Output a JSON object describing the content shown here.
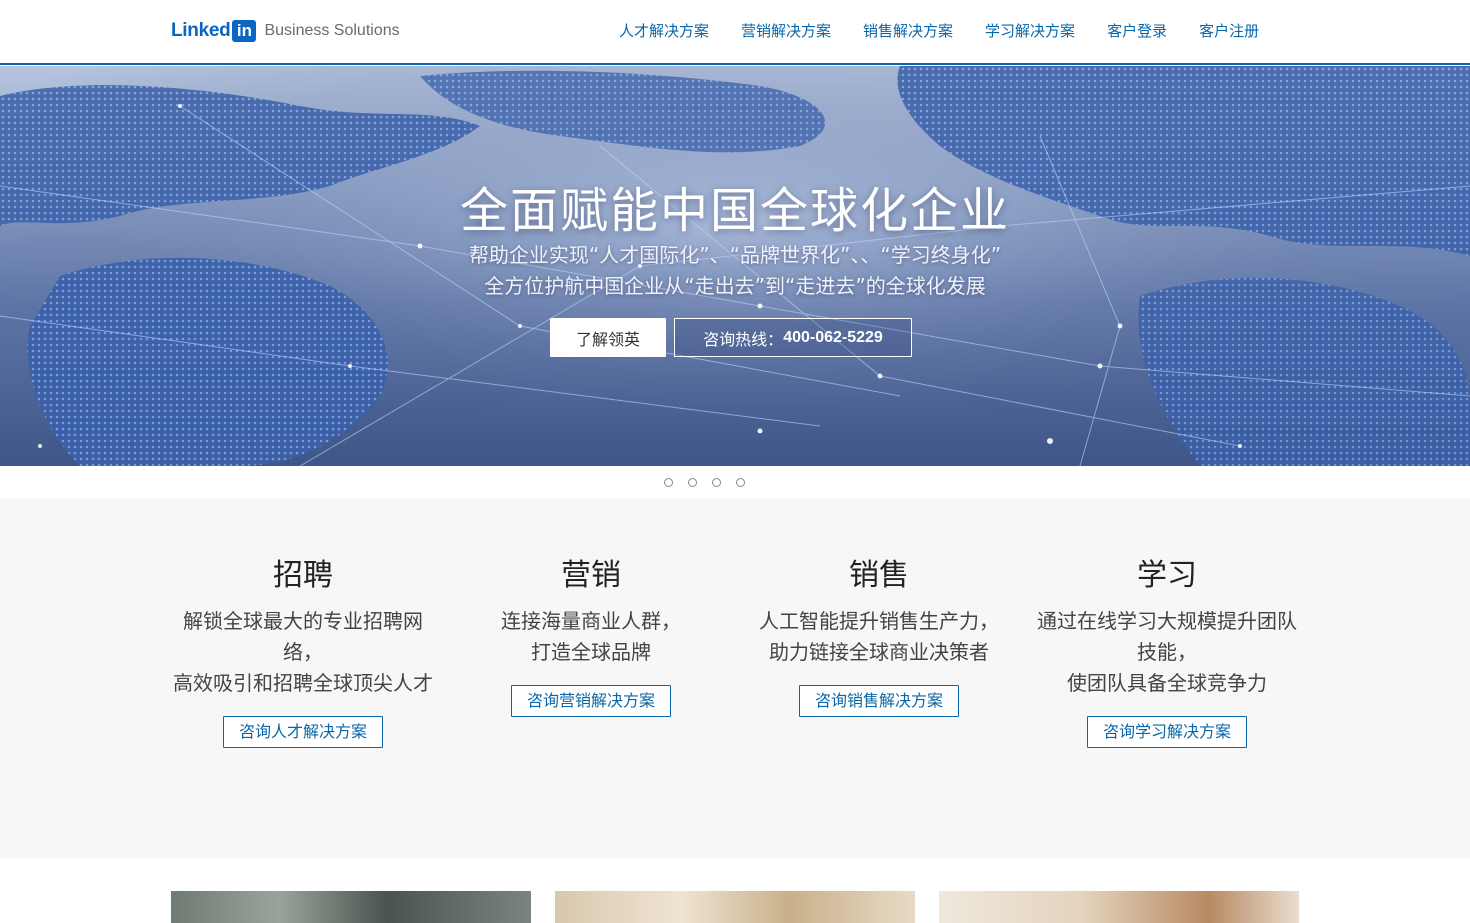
{
  "header": {
    "logo_linked": "Linked",
    "logo_in": "in",
    "logo_sub": "Business Solutions",
    "nav": [
      "人才解决方案",
      "营销解决方案",
      "销售解决方案",
      "学习解决方案",
      "客户登录",
      "客户注册"
    ]
  },
  "hero": {
    "title": "全面赋能中国全球化企业",
    "subtitle_1": "帮助企业实现“人才国际化”、“品牌世界化”、、“学习终身化”",
    "subtitle_2": "全方位护航中国企业从“走出去”到“走进去”的全球化发展",
    "learn_button": "了解领英",
    "hotline_label": "咨询热线：",
    "hotline_number": "400-062-5229"
  },
  "carousel": {
    "dots": 4
  },
  "solutions": [
    {
      "title": "招聘",
      "desc_1": "解锁全球最大的专业招聘网",
      "desc_2": "络，",
      "desc_3": "高效吸引和招聘全球顶尖人才",
      "cta": "咨询人才解决方案"
    },
    {
      "title": "营销",
      "desc_1": "连接海量商业人群，",
      "desc_2": "打造全球品牌",
      "desc_3": "",
      "cta": "咨询营销解决方案"
    },
    {
      "title": "销售",
      "desc_1": "人工智能提升销售生产力，",
      "desc_2": "助力链接全球商业决策者",
      "desc_3": "",
      "cta": "咨询销售解决方案"
    },
    {
      "title": "学习",
      "desc_1": "通过在线学习大规模提升团队",
      "desc_2": "技能，",
      "desc_3": "使团队具备全球竞争力",
      "cta": "咨询学习解决方案"
    }
  ],
  "colors": {
    "brand": "#0a66c2",
    "nav": "#0a66a8",
    "section_bg": "#f7f7f7"
  }
}
